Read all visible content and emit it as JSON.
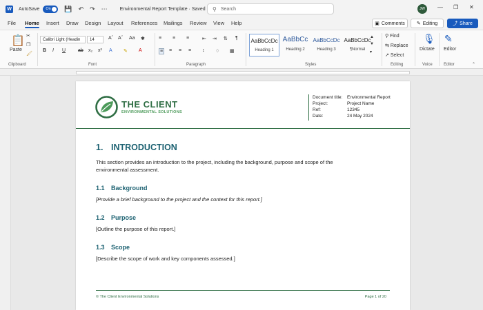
{
  "titlebar": {
    "autosave_label": "AutoSave",
    "autosave_state": "On",
    "document_title": "Environmental Report Template · Saved",
    "search_placeholder": "Search",
    "user_initials": "JW"
  },
  "menu": {
    "tabs": [
      "File",
      "Home",
      "Insert",
      "Draw",
      "Design",
      "Layout",
      "References",
      "Mailings",
      "Review",
      "View",
      "Help"
    ],
    "active_tab": "Home",
    "comments_label": "Comments",
    "editing_label": "Editing",
    "share_label": "Share"
  },
  "ribbon": {
    "paste_label": "Paste",
    "font_name": "Calibri Light (Headin",
    "font_size": "14",
    "styles": [
      {
        "sample": "AaBbCcDc",
        "name": "Heading 1"
      },
      {
        "sample": "AaBbCc",
        "name": "Heading 2"
      },
      {
        "sample": "AaBbCcDc",
        "name": "Heading 3"
      },
      {
        "sample": "AaBbCcDc",
        "name": "¶Normal"
      }
    ],
    "find_label": "Find",
    "replace_label": "Replace",
    "select_label": "Select",
    "dictate_label": "Dictate",
    "editor_label": "Editor",
    "group_labels": {
      "clipboard": "Clipboard",
      "font": "Font",
      "paragraph": "Paragraph",
      "styles": "Styles",
      "editing": "Editing",
      "voice": "Voice",
      "editor": "Editor"
    }
  },
  "page": {
    "brand_name": "THE CLIENT",
    "brand_tagline": "ENVIRONMENTAL SOLUTIONS",
    "meta": [
      {
        "key": "Document title:",
        "value": "Environmental Report"
      },
      {
        "key": "Project:",
        "value": "Project Name"
      },
      {
        "key": "Ref:",
        "value": "12345"
      },
      {
        "key": "Date:",
        "value": "24 May 2024"
      }
    ],
    "heading1": {
      "num": "1.",
      "text": "INTRODUCTION"
    },
    "intro_line1": "This section provides an introduction to the project, including the background, purpose and scope of the",
    "intro_line2": "environmental assessment.",
    "sections": [
      {
        "num": "1.1",
        "title": "Background",
        "body": "[Provide a brief background to the project and the context for this report.]",
        "italic": true
      },
      {
        "num": "1.2",
        "title": "Purpose",
        "body": "[Outline the purpose of this report.]",
        "italic": false
      },
      {
        "num": "1.3",
        "title": "Scope",
        "body": "[Describe the scope of work and key components assessed.]",
        "italic": false
      }
    ],
    "footer_left": "© The Client Environmental Solutions",
    "footer_right": "Page 1 of 20"
  },
  "colors": {
    "accent": "#185abd",
    "brand_green": "#2f6e44",
    "heading_teal": "#1d6272"
  }
}
